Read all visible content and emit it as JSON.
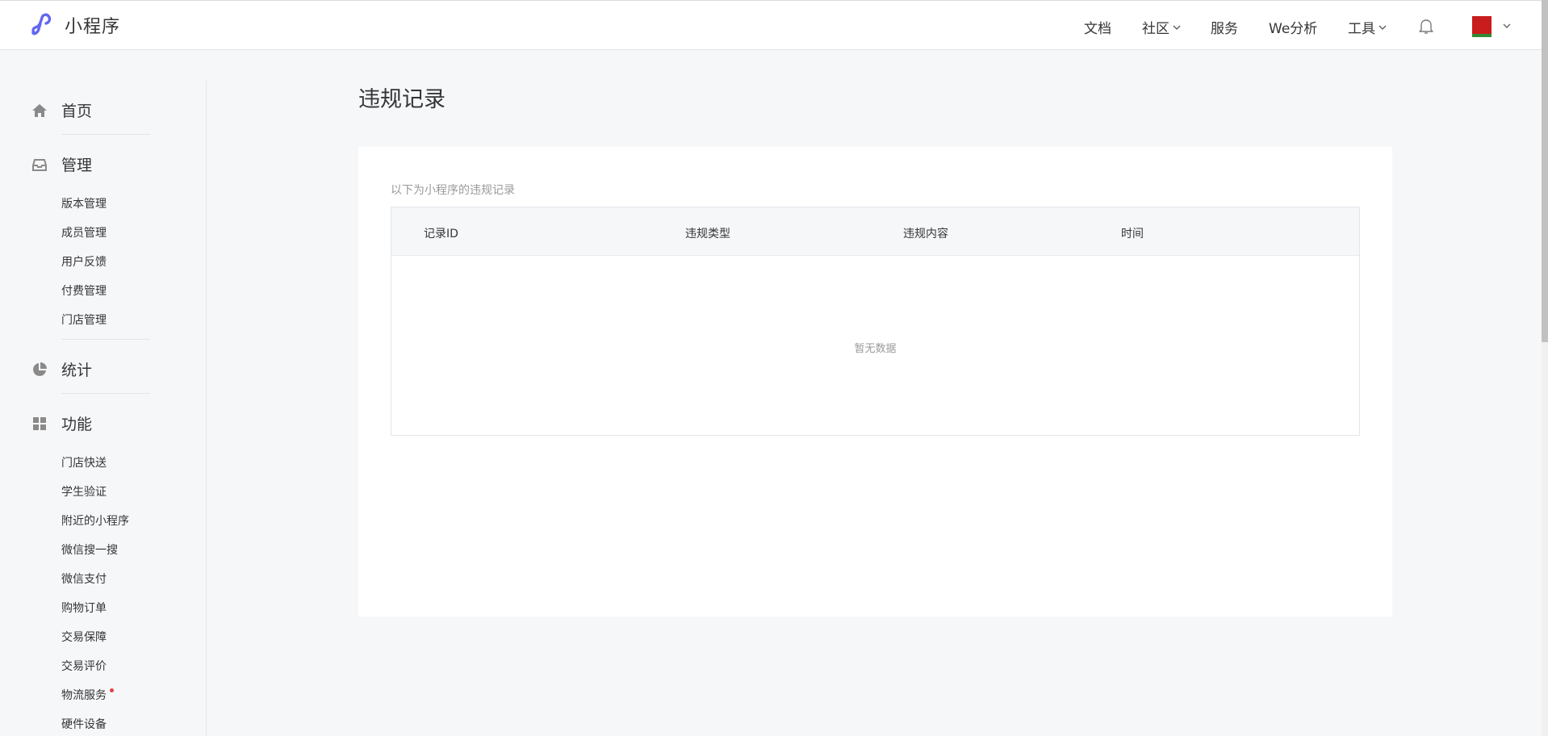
{
  "header": {
    "app_title": "小程序",
    "nav": [
      {
        "label": "文档",
        "has_dropdown": false
      },
      {
        "label": "社区",
        "has_dropdown": true
      },
      {
        "label": "服务",
        "has_dropdown": false
      },
      {
        "label": "We分析",
        "has_dropdown": false
      },
      {
        "label": "工具",
        "has_dropdown": true
      }
    ]
  },
  "sidebar": {
    "home": {
      "label": "首页",
      "icon": "home-icon"
    },
    "manage": {
      "label": "管理",
      "icon": "inbox-icon",
      "items": [
        "版本管理",
        "成员管理",
        "用户反馈",
        "付费管理",
        "门店管理"
      ]
    },
    "stats": {
      "label": "统计",
      "icon": "pie-chart-icon"
    },
    "features": {
      "label": "功能",
      "icon": "grid-icon",
      "items": [
        "门店快送",
        "学生验证",
        "附近的小程序",
        "微信搜一搜",
        "微信支付",
        "购物订单",
        "交易保障",
        "交易评价",
        "物流服务",
        "硬件设备"
      ]
    }
  },
  "main": {
    "title": "违规记录",
    "description": "以下为小程序的违规记录",
    "table": {
      "columns": [
        "记录ID",
        "违规类型",
        "违规内容",
        "时间"
      ],
      "rows": [],
      "empty_text": "暂无数据"
    }
  },
  "colors": {
    "brand": "#6467f0",
    "background": "#f6f7f9",
    "text": "#353535",
    "muted": "#9a9a9a",
    "badge_dot": "#e64340"
  }
}
